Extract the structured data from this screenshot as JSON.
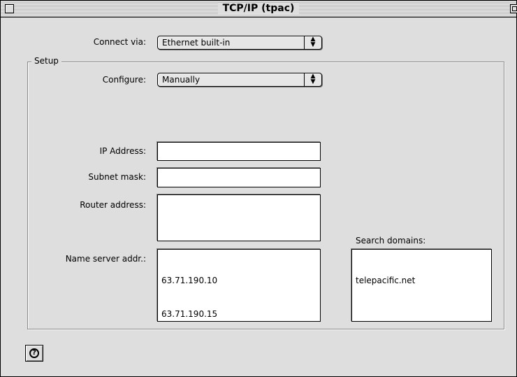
{
  "window": {
    "title": "TCP/IP (tpac)"
  },
  "connect_via": {
    "label": "Connect via:",
    "value": "Ethernet built-in"
  },
  "setup": {
    "legend": "Setup",
    "configure": {
      "label": "Configure:",
      "value": "Manually"
    },
    "ip_address": {
      "label": "IP Address:",
      "value": ""
    },
    "subnet_mask": {
      "label": "Subnet mask:",
      "value": ""
    },
    "router_address": {
      "label": "Router address:",
      "value": ""
    },
    "name_server": {
      "label": "Name server addr.:",
      "values": [
        "63.71.190.10",
        "63.71.190.15"
      ]
    },
    "search_domains": {
      "label": "Search domains:",
      "values": [
        "telepacific.net"
      ]
    }
  },
  "help": {
    "glyph": "?"
  }
}
